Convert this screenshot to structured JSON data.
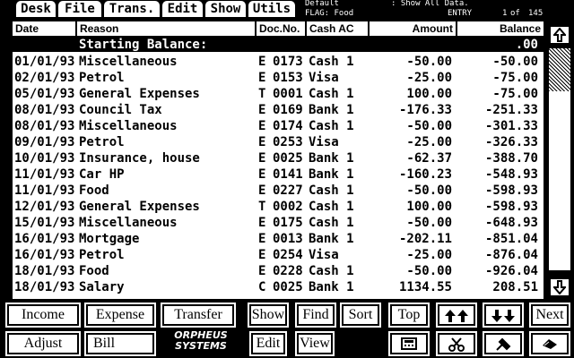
{
  "menu": [
    {
      "label": "Desk"
    },
    {
      "label": "File"
    },
    {
      "label": "Trans."
    },
    {
      "label": "Edit"
    },
    {
      "label": "Show"
    },
    {
      "label": "Utils"
    }
  ],
  "info": {
    "line1_left": "Default",
    "line1_right": ": Show All Data.",
    "line2_left": "FLAG: Food",
    "entry_label": "ENTRY",
    "entry_pos": "1",
    "entry_of": "of",
    "entry_total": "145"
  },
  "columns": [
    "Date",
    "Reason",
    "Doc.No.",
    "Cash AC",
    "Amount",
    "Balance"
  ],
  "starting_balance": {
    "label": "Starting Balance:",
    "value": ".00"
  },
  "rows": [
    {
      "date": "01/01/93",
      "reason": "Miscellaneous",
      "type": "E",
      "doc": "0173",
      "account": "Cash 1",
      "amount": "-50.00",
      "balance": "-50.00"
    },
    {
      "date": "02/01/93",
      "reason": "Petrol",
      "type": "E",
      "doc": "0153",
      "account": "Visa",
      "amount": "-25.00",
      "balance": "-75.00"
    },
    {
      "date": "05/01/93",
      "reason": "General Expenses",
      "type": "T",
      "doc": "0001",
      "account": "Cash 1",
      "amount": "100.00",
      "balance": "-75.00"
    },
    {
      "date": "08/01/93",
      "reason": "Council Tax",
      "type": "E",
      "doc": "0169",
      "account": "Bank 1",
      "amount": "-176.33",
      "balance": "-251.33"
    },
    {
      "date": "08/01/93",
      "reason": "Miscellaneous",
      "type": "E",
      "doc": "0174",
      "account": "Cash 1",
      "amount": "-50.00",
      "balance": "-301.33"
    },
    {
      "date": "09/01/93",
      "reason": "Petrol",
      "type": "E",
      "doc": "0253",
      "account": "Visa",
      "amount": "-25.00",
      "balance": "-326.33"
    },
    {
      "date": "10/01/93",
      "reason": "Insurance, house",
      "type": "E",
      "doc": "0025",
      "account": "Bank 1",
      "amount": "-62.37",
      "balance": "-388.70"
    },
    {
      "date": "11/01/93",
      "reason": "Car HP",
      "type": "E",
      "doc": "0141",
      "account": "Bank 1",
      "amount": "-160.23",
      "balance": "-548.93"
    },
    {
      "date": "11/01/93",
      "reason": "Food",
      "type": "E",
      "doc": "0227",
      "account": "Cash 1",
      "amount": "-50.00",
      "balance": "-598.93"
    },
    {
      "date": "12/01/93",
      "reason": "General Expenses",
      "type": "T",
      "doc": "0002",
      "account": "Cash 1",
      "amount": "100.00",
      "balance": "-598.93"
    },
    {
      "date": "15/01/93",
      "reason": "Miscellaneous",
      "type": "E",
      "doc": "0175",
      "account": "Cash 1",
      "amount": "-50.00",
      "balance": "-648.93"
    },
    {
      "date": "16/01/93",
      "reason": "Mortgage",
      "type": "E",
      "doc": "0013",
      "account": "Bank 1",
      "amount": "-202.11",
      "balance": "-851.04"
    },
    {
      "date": "16/01/93",
      "reason": "Petrol",
      "type": "E",
      "doc": "0254",
      "account": "Visa",
      "amount": "-25.00",
      "balance": "-876.04"
    },
    {
      "date": "18/01/93",
      "reason": "Food",
      "type": "E",
      "doc": "0228",
      "account": "Cash 1",
      "amount": "-50.00",
      "balance": "-926.04"
    },
    {
      "date": "18/01/93",
      "reason": "Salary",
      "type": "C",
      "doc": "0025",
      "account": "Bank 1",
      "amount": "1134.55",
      "balance": "208.51"
    }
  ],
  "scroll": {
    "up_icon": "arrow-up-icon",
    "down_icon": "arrow-down-icon"
  },
  "buttons": {
    "income": "Income",
    "expense": "Expense",
    "transfer": "Transfer",
    "show": "Show",
    "find": "Find",
    "sort": "Sort",
    "top": "Top",
    "next": "Next",
    "adjust": "Adjust",
    "bill": "Bill",
    "edit": "Edit",
    "view": "View"
  },
  "icons": {
    "page_up": "double-up-arrow-icon",
    "page_down": "double-down-arrow-icon",
    "calculator": "calculator-icon",
    "scissors": "scissors-icon",
    "tools": "tools-icon",
    "erase": "eraser-icon"
  },
  "logo": {
    "line1": "ORPHEUS",
    "line2": "SYSTEMS"
  },
  "colors": {
    "background": "#000000",
    "foreground": "#ffffff"
  }
}
